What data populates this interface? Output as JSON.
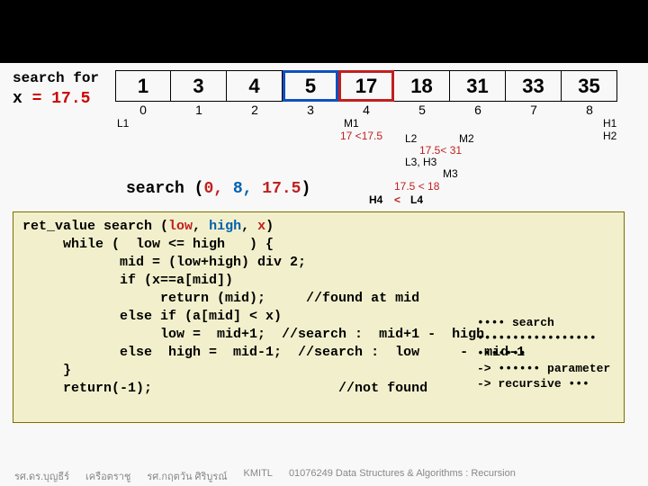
{
  "header": {
    "search_for": "search for",
    "x_lhs": "x",
    "x_eq": "=",
    "x_val": "17.5"
  },
  "array": {
    "values": [
      "1",
      "3",
      "4",
      "5",
      "17",
      "18",
      "31",
      "33",
      "35"
    ],
    "indices": [
      "0",
      "1",
      "2",
      "3",
      "4",
      "5",
      "6",
      "7",
      "8"
    ]
  },
  "annotations": {
    "L1": "L1",
    "M1": "M1",
    "cmp1": "17 <17.5",
    "L2": "L2",
    "M2": "M2",
    "cmp2": "17.5< 31",
    "L3H3": "L3, H3",
    "M3": "M3",
    "cmp3": "17.5 < 18",
    "H4": "H4",
    "lt": "<",
    "L4": "L4",
    "H1": "H1",
    "H2": "H2"
  },
  "call": {
    "name": "search",
    "open": "(",
    "a1": "0,",
    "a2": "8,",
    "a3": "17.5",
    "close": ")"
  },
  "code": {
    "l1a": "ret_value ",
    "l1b": "search (",
    "l1_low": "low",
    "l1_c1": ",  ",
    "l1_high": "high",
    "l1_c2": ",  ",
    "l1_x": "x",
    "l1_end": ")",
    "l2": "     while (  low <= high   ) {",
    "l3": "            mid = (low+high) div 2;",
    "l4": "            if (x==a[mid])",
    "l5": "                 return (mid);     //found at mid",
    "l6": "            else if (a[mid] < x)",
    "l7": "                 low =  mid+1;  //search :  mid+1 -  high",
    "l8": "            else  high =  mid-1;  //search :  low     -  mid-1",
    "l9": "     }",
    "l10": "     return(-1);                       //not found"
  },
  "sidenote": {
    "l1": "•••• search",
    "l2": "•••••••••••••••••",
    "l3": "•••••••",
    "l4": "-> •••••• parameter",
    "l5": "-> recursive •••"
  },
  "footer": {
    "a": "รศ.ดร.บุญธีร์",
    "b": "เครือตราชู",
    "c": "รศ.กฤตวัน  ศิริบูรณ์",
    "d": "KMITL",
    "e": "01076249 Data Structures & Algorithms : Recursion"
  }
}
